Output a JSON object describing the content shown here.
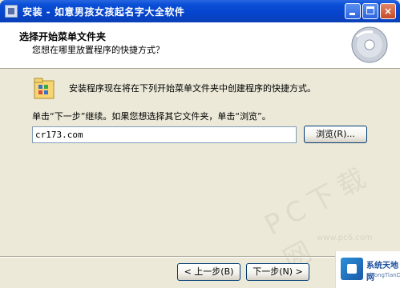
{
  "window": {
    "title": "安装 - 如意男孩女孩起名字大全软件",
    "controls": {
      "minimize": "minimize",
      "maximize": "maximize",
      "close": "×"
    }
  },
  "header": {
    "title": "选择开始菜单文件夹",
    "subtitle": "您想在哪里放置程序的快捷方式？"
  },
  "content": {
    "message1": "安装程序现在将在下列开始菜单文件夹中创建程序的快捷方式。",
    "message2": "单击“下一步”继续。如果您想选择其它文件夹，单击“浏览”。",
    "folder_value": "cr173.com",
    "browse_label": "浏览(R)..."
  },
  "footer": {
    "prev_label": "< 上一步(B)",
    "next_label": "下一步(N) >"
  },
  "watermark": {
    "text": "PC下载网",
    "sub": "www.pc6.com"
  },
  "logo": {
    "text": "系统天地网",
    "url": "XiTongTianDi.net"
  },
  "icons": [
    "app-icon",
    "minimize-icon",
    "maximize-icon",
    "close-icon",
    "disc-icon",
    "start-menu-folder-icon"
  ],
  "colors": {
    "titlebar": "#0a4fd6",
    "dialog_bg": "#ece9d8",
    "close_btn": "#c34a2a",
    "border": "#003c74"
  }
}
